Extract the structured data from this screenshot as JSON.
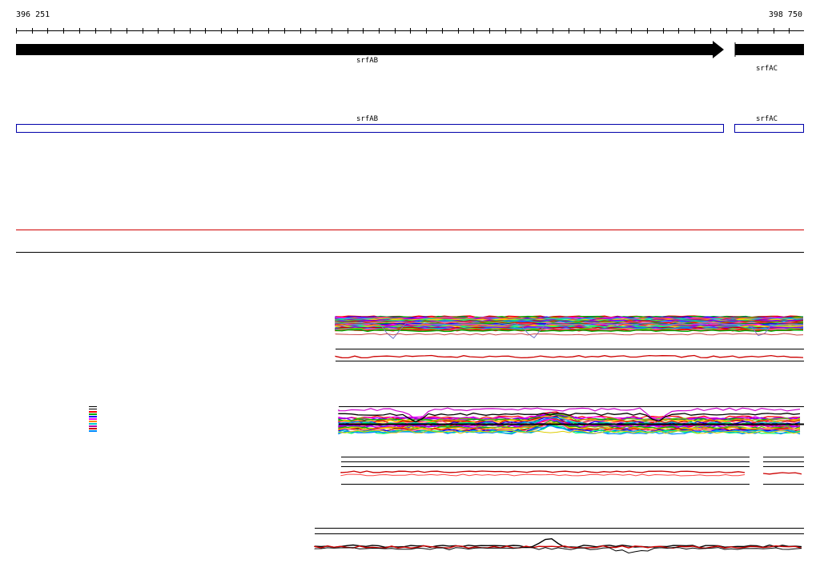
{
  "ruler": {
    "start": "396 251",
    "end": "398 750"
  },
  "genes": [
    {
      "name": "srfAB",
      "strand": "+",
      "start_frac": 0.0,
      "end_frac": 0.9
    },
    {
      "name": "srfAC",
      "strand": "+",
      "start_frac": 0.914,
      "end_frac": 1.0
    }
  ],
  "annotation_track": [
    {
      "name": "srfAB"
    },
    {
      "name": "srfAC"
    }
  ],
  "colors": {
    "gene_fill": "#000000",
    "annotation_outline": "#0000aa",
    "red_line": "#d00000",
    "baseline": "#000000"
  },
  "legend_swatch_colors": [
    "#000000",
    "#000000",
    "#ff0000",
    "#00aa00",
    "#0000ff",
    "#ff00ff",
    "#ff8800",
    "#00cccc",
    "#aa00aa",
    "#cc0000",
    "#0088ff"
  ]
}
